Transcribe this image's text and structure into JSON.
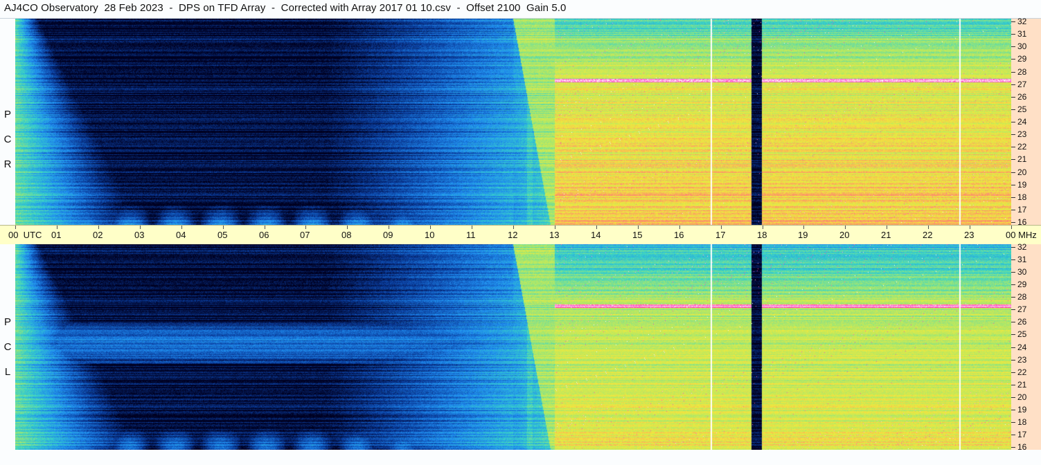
{
  "title": "AJ4CO Observatory  28 Feb 2023  -  DPS on TFD Array  -  Corrected with Array 2017 01 10.csv  -  Offset 2100  Gain 5.0",
  "panels": [
    {
      "id": "rcp",
      "letters": [
        "R",
        "C",
        "P"
      ]
    },
    {
      "id": "lcp",
      "letters": [
        "L",
        "C",
        "P"
      ]
    }
  ],
  "chart_data": {
    "type": "heatmap",
    "title": "AJ4CO Observatory  28 Feb 2023  -  DPS on TFD Array  -  Corrected with Array 2017 01 10.csv  -  Offset 2100  Gain 5.0",
    "x_axis": {
      "labels": [
        "00",
        "01",
        "02",
        "03",
        "04",
        "05",
        "06",
        "07",
        "08",
        "09",
        "10",
        "11",
        "12",
        "13",
        "14",
        "15",
        "16",
        "17",
        "18",
        "19",
        "20",
        "21",
        "22",
        "23",
        "00"
      ],
      "first_label_suffix": "UTC",
      "last_label_suffix": "MHz",
      "range": [
        0,
        24
      ],
      "unit": "UTC hours"
    },
    "y_axis": {
      "labels": [
        "32",
        "31",
        "30",
        "29",
        "28",
        "27",
        "26",
        "25",
        "24",
        "23",
        "22",
        "21",
        "20",
        "19",
        "18",
        "17",
        "16"
      ],
      "range": [
        16,
        32
      ],
      "unit": "MHz"
    },
    "series": [
      {
        "name": "RCP",
        "label": "R C P"
      },
      {
        "name": "LCP",
        "label": "L C P"
      }
    ],
    "colormap": [
      "#000020",
      "#0a3c9c",
      "#1f8cf0",
      "#38d2c8",
      "#a8e86c",
      "#f2e83c",
      "#ff7a78",
      "#ff44c8",
      "#ffffff"
    ],
    "features": {
      "vertical_line_hours": [
        16.75,
        22.75
      ],
      "dark_band_hours": [
        17.75,
        18.0
      ],
      "bright_band_hour": 12.4,
      "interference_bands_mhz": [
        27.1,
        27.3
      ]
    }
  }
}
